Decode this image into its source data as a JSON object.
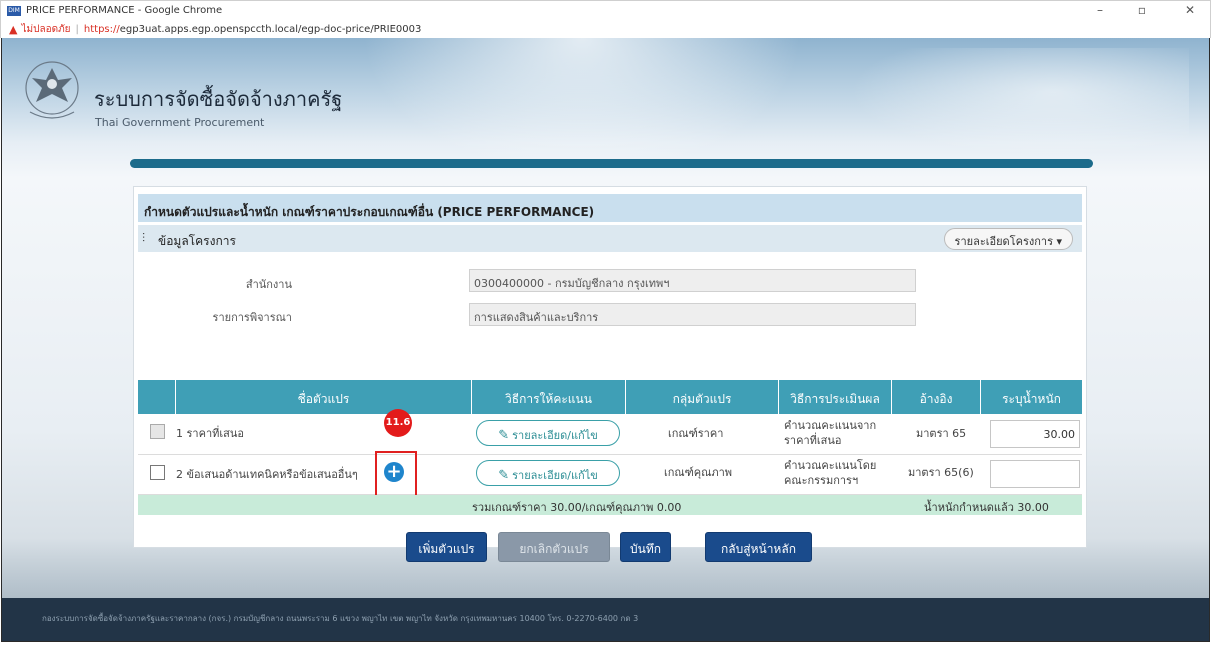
{
  "window": {
    "title": "PRICE PERFORMANCE - Google Chrome",
    "app_icon": "DIM",
    "minimize": "–",
    "restore": "▫",
    "close": "✕"
  },
  "address_bar": {
    "security_label": "ไม่ปลอดภัย",
    "url_scheme": "https://",
    "url_rest": "egp3uat.apps.egp.openspccth.local/egp-doc-price/PRIE0003"
  },
  "header": {
    "site_title": "ระบบการจัดซื้อจัดจ้างภาครัฐ",
    "site_subtitle": "Thai Government Procurement"
  },
  "panel": {
    "heading": "กำหนดตัวแปรและน้ำหนัก เกณฑ์ราคาประกอบเกณฑ์อื่น (PRICE PERFORMANCE)",
    "project_label": "ข้อมูลโครงการ",
    "project_detail_button": "รายละเอียดโครงการ ▾"
  },
  "form": {
    "office_label": "สำนักงาน",
    "office_value": "0300400000 - กรมบัญชีกลาง กรุงเทพฯ",
    "item_label": "รายการพิจารณา",
    "item_value": "การแสดงสินค้าและบริการ"
  },
  "table": {
    "headers": [
      "ชื่อตัวแปร",
      "วิธีการให้คะแนน",
      "กลุ่มตัวแปร",
      "วิธีการประเมินผล",
      "อ้างอิง",
      "ระบุน้ำหนัก"
    ],
    "rows": [
      {
        "name": "1 ราคาที่เสนอ",
        "scoring_button": "รายละเอียด/แก้ไข",
        "group": "เกณฑ์ราคา",
        "evaluation": "คำนวณคะแนนจากราคาที่เสนอ",
        "reference": "มาตรา 65",
        "weight": "30.00"
      },
      {
        "name": "2 ข้อเสนอด้านเทคนิคหรือข้อเสนออื่นๆ",
        "scoring_button": "รายละเอียด/แก้ไข",
        "group": "เกณฑ์คุณภาพ",
        "evaluation": "คำนวณคะแนนโดยคณะกรรมการฯ",
        "reference": "มาตรา 65(6)",
        "weight": ""
      }
    ]
  },
  "annotation": {
    "step": "11.6"
  },
  "summary": {
    "totals": "รวมเกณฑ์ราคา 30.00/เกณฑ์คุณภาพ 0.00",
    "assigned_weight": "น้ำหนักกำหนดแล้ว 30.00"
  },
  "buttons": {
    "add_variable": "เพิ่มตัวแปร",
    "cancel_variable": "ยกเลิกตัวแปร",
    "save": "บันทึก",
    "back_home": "กลับสู่หน้าหลัก"
  },
  "footer": {
    "text": "กองระบบการจัดซื้อจัดจ้างภาครัฐและราคากลาง (กจร.) กรมบัญชีกลาง ถนนพระราม 6 แขวง พญาไท เขต พญาไท จังหวัด กรุงเทพมหานคร 10400 โทร. 0-2270-6400 กด 3"
  },
  "colors": {
    "table_header": "#3f9fb6",
    "summary_row": "#c8ebd9",
    "primary_button": "#1a4b8c",
    "highlight": "#e02020"
  }
}
